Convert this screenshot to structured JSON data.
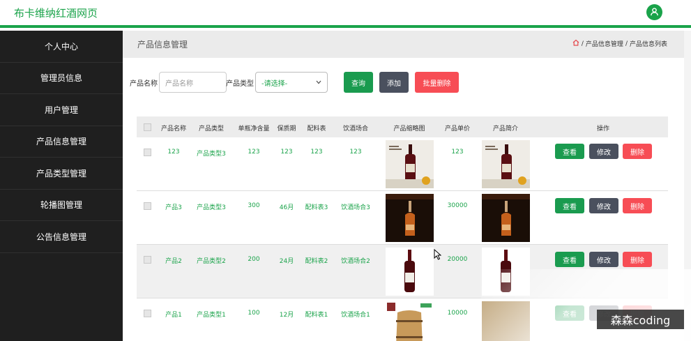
{
  "header": {
    "site_title": "布卡维纳红酒网页",
    "avatar_icon": "user-icon"
  },
  "sidebar": {
    "items": [
      {
        "label": "个人中心"
      },
      {
        "label": "管理员信息"
      },
      {
        "label": "用户管理"
      },
      {
        "label": "产品信息管理"
      },
      {
        "label": "产品类型管理"
      },
      {
        "label": "轮播图管理"
      },
      {
        "label": "公告信息管理"
      }
    ]
  },
  "page": {
    "title": "产品信息管理",
    "breadcrumb": {
      "home_icon": "home-icon",
      "sep": "/",
      "level1": "产品信息管理",
      "level2": "产品信息列表"
    }
  },
  "search": {
    "name_label": "产品名称",
    "name_placeholder": "产品名称",
    "type_label": "产品类型",
    "type_selected": "-请选择-",
    "query_button": "查询",
    "add_button": "添加",
    "batch_delete_button": "批量删除"
  },
  "table": {
    "headers": [
      "产品名称",
      "产品类型",
      "单瓶净含量",
      "保质期",
      "配料表",
      "饮酒场合",
      "产品缩略图",
      "产品单价",
      "产品简介",
      "操作"
    ],
    "rows": [
      {
        "name": "123",
        "type": "产品类型3",
        "volume": "123",
        "shelf_life": "123",
        "ingredients": "123",
        "occasion": "123",
        "price": "123",
        "image": "wine-bottle-poster"
      },
      {
        "name": "产品3",
        "type": "产品类型3",
        "volume": "300",
        "shelf_life": "46月",
        "ingredients": "配料表3",
        "occasion": "饮酒场合3",
        "price": "30000",
        "image": "wine-bottle-dark"
      },
      {
        "name": "产品2",
        "type": "产品类型2",
        "volume": "200",
        "shelf_life": "24月",
        "ingredients": "配料表2",
        "occasion": "饮酒场合2",
        "price": "20000",
        "image": "wine-bottle-white"
      },
      {
        "name": "产品1",
        "type": "产品类型1",
        "volume": "100",
        "shelf_life": "12月",
        "ingredients": "配料表1",
        "occasion": "饮酒场合1",
        "price": "10000",
        "image": "wine-barrel"
      }
    ],
    "actions": {
      "view": "查看",
      "edit": "修改",
      "delete": "删除"
    }
  },
  "watermark": "森森coding",
  "colors": {
    "accent": "#1aa34a",
    "sidebar_bg": "#1f1f1f",
    "danger": "#f74d55",
    "dark_button": "#4a505e"
  }
}
